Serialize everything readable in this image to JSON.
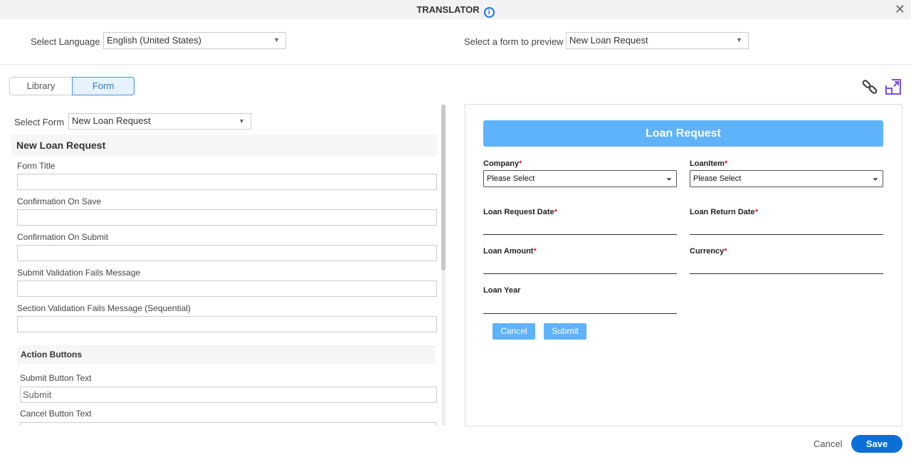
{
  "window": {
    "title": "TRANSLATOR",
    "info_icon": "info-icon",
    "close_icon": "close-icon"
  },
  "top": {
    "language_label": "Select Language",
    "language_value": "English (United States)",
    "preview_label": "Select a form to preview",
    "preview_value": "New Loan Request"
  },
  "tabs": [
    {
      "label": "Library",
      "active": false
    },
    {
      "label": "Form",
      "active": true
    }
  ],
  "left": {
    "select_form_label": "Select Form",
    "select_form_value": "New Loan Request",
    "section_title": "New Loan Request",
    "fields": [
      {
        "label": "Form Title",
        "value": ""
      },
      {
        "label": "Confirmation On Save",
        "value": ""
      },
      {
        "label": "Confirmation On Submit",
        "value": ""
      },
      {
        "label": "Submit Validation Fails Message",
        "value": ""
      },
      {
        "label": "Section Validation Fails Message (Sequential)",
        "value": ""
      }
    ],
    "action_section": "Action Buttons",
    "action_fields": [
      {
        "label": "Submit Button Text",
        "value": "Submit"
      },
      {
        "label": "Cancel Button Text",
        "value": ""
      }
    ]
  },
  "preview": {
    "title": "Loan Request",
    "company_label": "Company",
    "loanitem_label": "LoanItem",
    "select_placeholder": "Please Select",
    "req": "*",
    "request_date_label": "Loan Request Date",
    "return_date_label": "Loan Return Date",
    "amount_label": "Loan Amount",
    "currency_label": "Currency",
    "year_label": "Loan Year",
    "cancel": "Cancel",
    "submit": "Submit",
    "header_color": "#5fb3fb"
  },
  "footer": {
    "cancel": "Cancel",
    "save": "Save",
    "save_color": "#0a6fd8"
  }
}
